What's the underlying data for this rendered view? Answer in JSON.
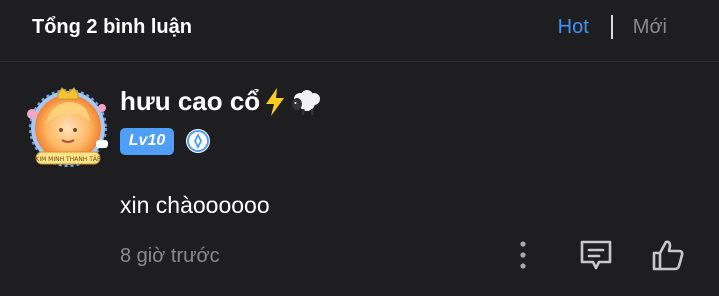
{
  "header": {
    "total_label": "Tổng 2 bình luận",
    "sort_hot": "Hot",
    "sort_new": "Mới"
  },
  "comment": {
    "username": "hưu cao cổ",
    "username_emojis": [
      "lightning-icon",
      "sheep-icon"
    ],
    "level": "Lv10",
    "avatar_frame_text": "KIM MINH THANH TẬP",
    "text": "xin chàoooooo",
    "time": "8 giờ trước"
  },
  "colors": {
    "background": "#1e1e21",
    "accent": "#3d93f5",
    "muted": "#8a8a8e",
    "level_badge": "#4f9ef7"
  }
}
